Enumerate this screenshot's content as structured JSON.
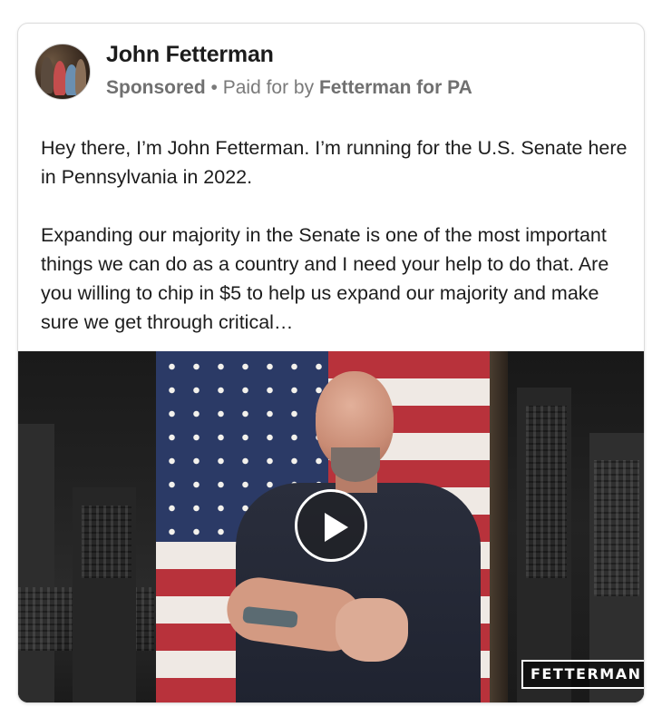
{
  "post": {
    "author_name": "John Fetterman",
    "sponsored_label": "Sponsored",
    "separator": " • ",
    "paid_for_prefix": "Paid for by ",
    "paid_for_entity": "Fetterman for PA",
    "body_paragraph_1": "Hey there, I’m John Fetterman. I’m running for the U.S. Senate here in Pennsylvania in 2022.",
    "body_paragraph_2": "Expanding our majority in the Senate is one of the most important things we can do as a country and I need your help to do that. Are you willing to chip in $5 to help us expand our majority and make sure we get through critical…"
  },
  "video": {
    "play_icon": "play-icon",
    "wordmark": "FETTERMAN"
  },
  "colors": {
    "flag_red": "#b8323b",
    "flag_blue": "#2b3a66",
    "text_primary": "#1c1c1c",
    "text_secondary": "#7a7a7a"
  }
}
